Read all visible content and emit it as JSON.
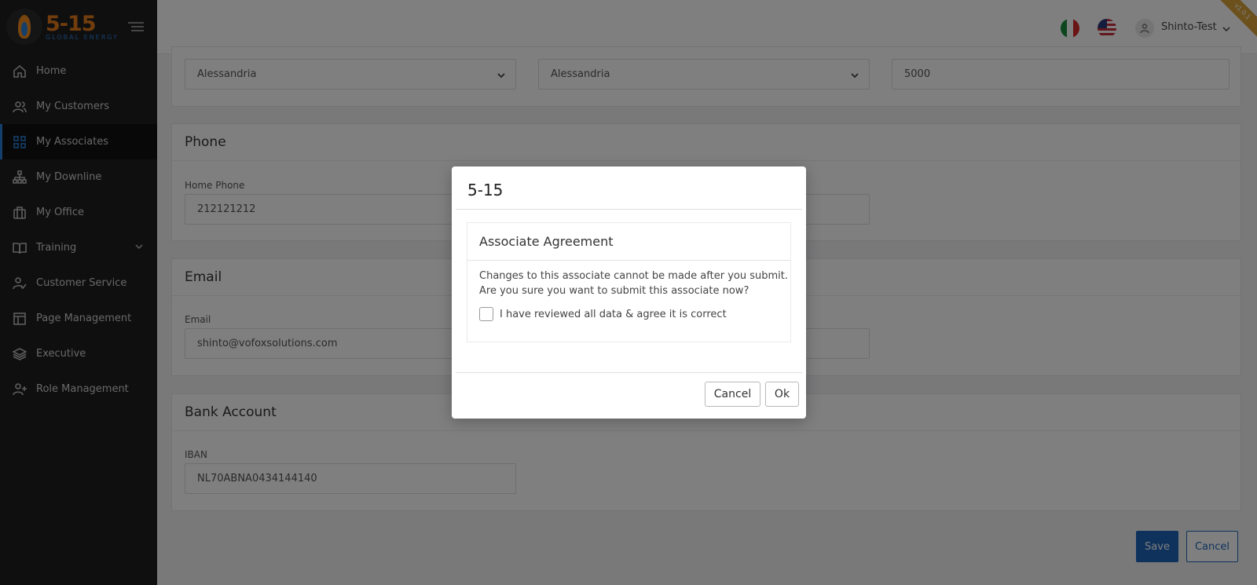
{
  "brand": {
    "logo_number": "5-15",
    "logo_subtitle": "GLOBAL ENERGY",
    "version": "v1.0.1"
  },
  "sidebar": {
    "items": [
      {
        "label": "Home",
        "icon": "home-icon"
      },
      {
        "label": "My Customers",
        "icon": "users-icon"
      },
      {
        "label": "My Associates",
        "icon": "grid-icon",
        "active": true
      },
      {
        "label": "My Downline",
        "icon": "hierarchy-icon"
      },
      {
        "label": "My Office",
        "icon": "briefcase-icon"
      },
      {
        "label": "Training",
        "icon": "book-icon",
        "has_submenu": true
      },
      {
        "label": "Customer Service",
        "icon": "user-check-icon"
      },
      {
        "label": "Page Management",
        "icon": "layout-icon"
      },
      {
        "label": "Executive",
        "icon": "layers-icon"
      },
      {
        "label": "Role Management",
        "icon": "user-plus-icon"
      }
    ]
  },
  "header": {
    "user_name": "Shinto-Test",
    "languages": [
      "Italian",
      "English"
    ]
  },
  "address": {
    "province": "Alessandria",
    "city": "Alessandria",
    "postal_code": "5000"
  },
  "phone": {
    "title": "Phone",
    "home_phone_label": "Home Phone",
    "home_phone": "212121212"
  },
  "email": {
    "title": "Email",
    "email_label": "Email",
    "email": "shinto@vofoxsolutions.com"
  },
  "bank": {
    "title": "Bank Account",
    "iban_label": "IBAN",
    "iban": "NL70ABNA0434144140"
  },
  "actions": {
    "save": "Save",
    "cancel": "Cancel"
  },
  "modal": {
    "title": "5-15",
    "section_title": "Associate Agreement",
    "message_line1": "Changes to this associate cannot be made after you submit.",
    "message_line2": "Are you sure you want to submit this associate now?",
    "checkbox_label": "I have reviewed all data & agree it is correct",
    "checkbox_checked": false,
    "cancel_label": "Cancel",
    "ok_label": "Ok"
  },
  "colors": {
    "accent": "#1e64b8",
    "sidebar_bg": "#1e1e1e",
    "brand_orange": "#e47b1a"
  }
}
